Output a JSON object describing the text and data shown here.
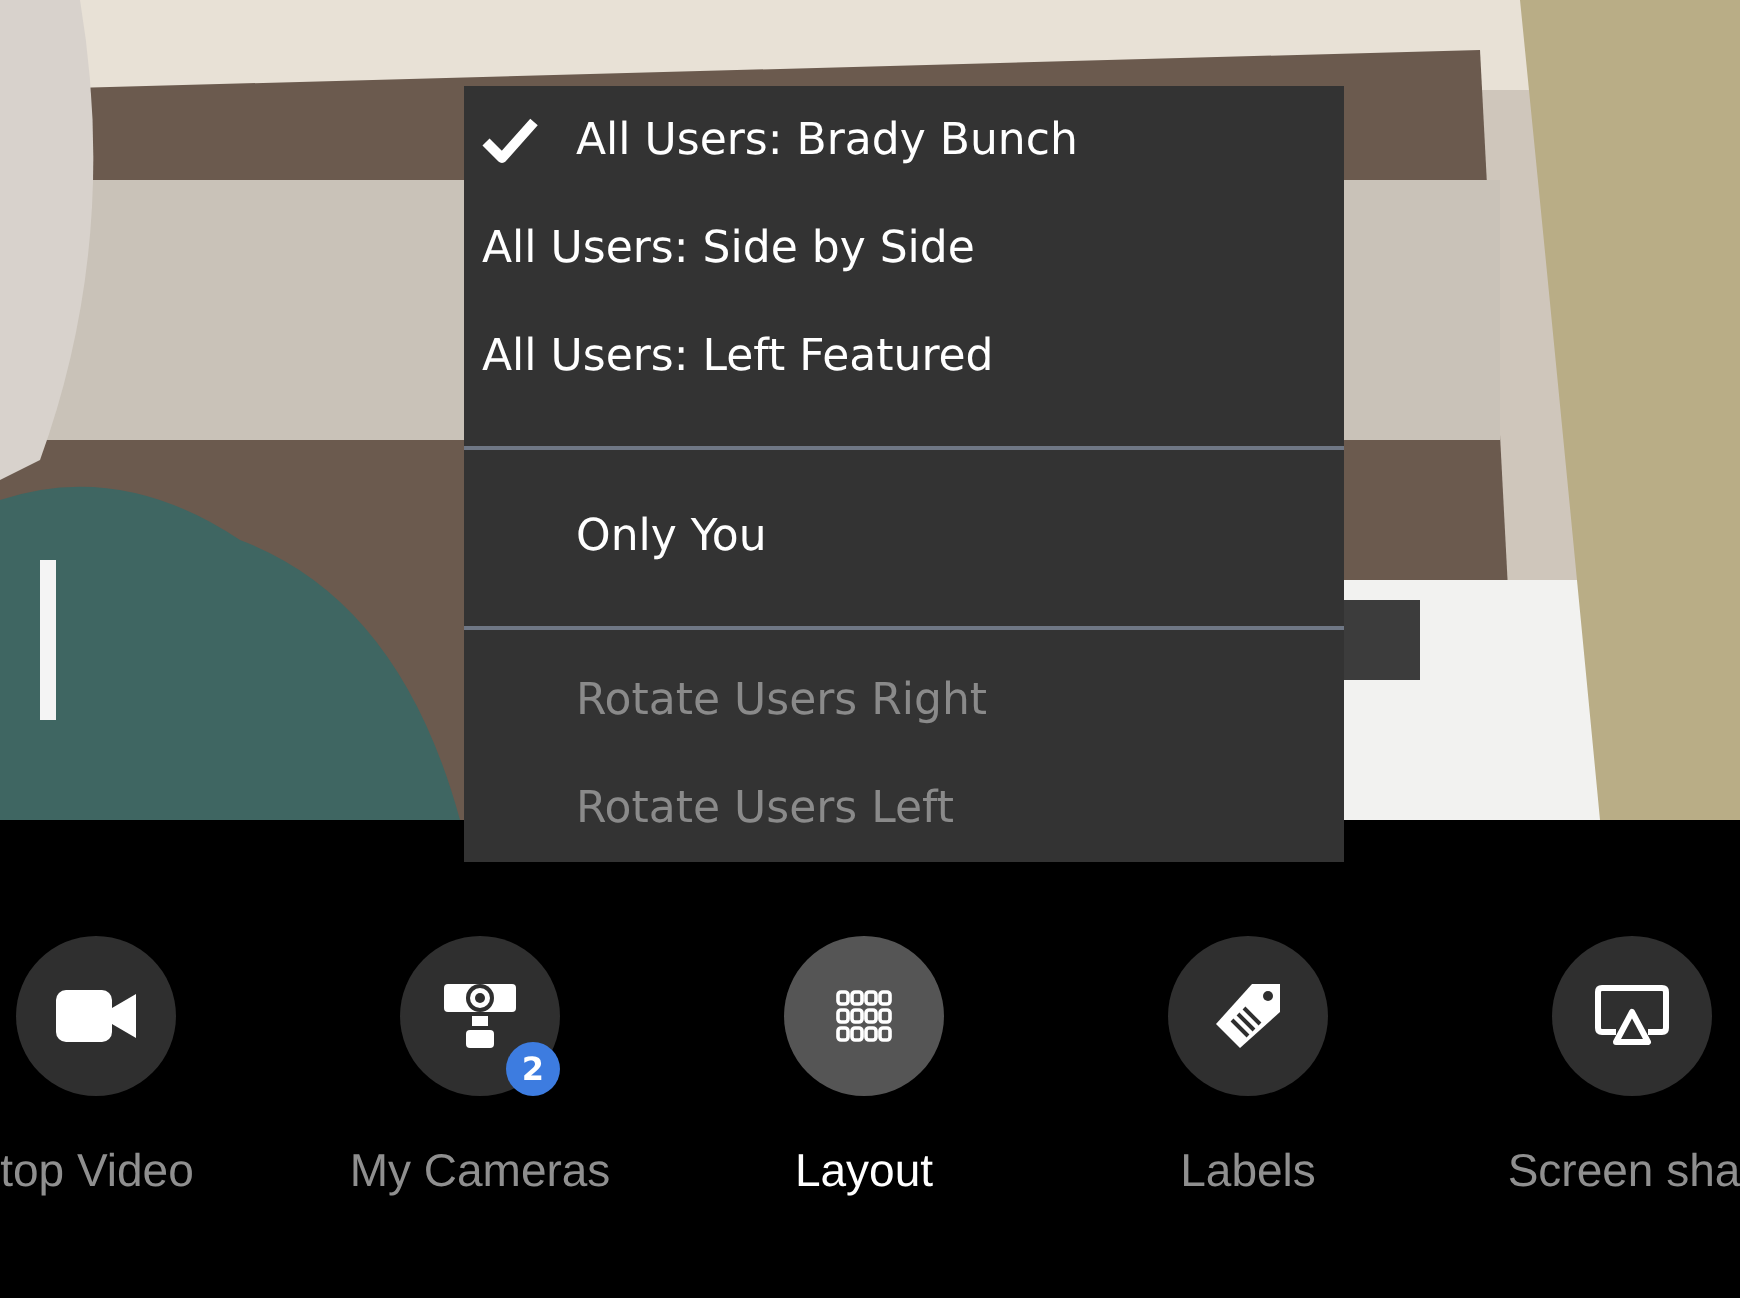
{
  "layout_menu": {
    "sections": [
      [
        {
          "label": "All Users: Brady Bunch",
          "kind": "option",
          "checked": true,
          "disabled": false
        },
        {
          "label": "All Users: Side by Side",
          "kind": "option",
          "checked": false,
          "disabled": false
        },
        {
          "label": "All Users: Left Featured",
          "kind": "option",
          "checked": false,
          "disabled": false
        }
      ],
      [
        {
          "label": "Only You",
          "kind": "padded",
          "checked": false,
          "disabled": false
        }
      ],
      [
        {
          "label": "Rotate Users Right",
          "kind": "padded",
          "checked": false,
          "disabled": true
        },
        {
          "label": "Rotate Users Left",
          "kind": "padded",
          "checked": false,
          "disabled": true
        }
      ]
    ]
  },
  "toolbar": [
    {
      "kind": "video",
      "label": "top Video",
      "selected": false
    },
    {
      "kind": "camera",
      "label": "My Cameras",
      "selected": false,
      "badge": "2"
    },
    {
      "kind": "grid",
      "label": "Layout",
      "selected": true
    },
    {
      "kind": "tag",
      "label": "Labels",
      "selected": false
    },
    {
      "kind": "screen",
      "label": "Screen sha",
      "selected": false
    }
  ]
}
